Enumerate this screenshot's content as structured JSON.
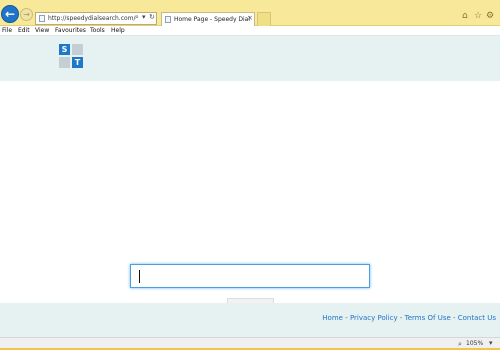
{
  "browser": {
    "address_url": "http://speedydialsearch.com/",
    "tab_title": "Home Page - Speedy Dial",
    "zoom": "105%",
    "menu": [
      "File",
      "Edit",
      "View",
      "Favourites",
      "Tools",
      "Help"
    ]
  },
  "page": {
    "logo": {
      "left": "S",
      "right": "T"
    },
    "footer": {
      "links": [
        "Home",
        "Privacy Policy",
        "Terms Of Use",
        "Contact Us"
      ],
      "separator": " - "
    }
  },
  "colors": {
    "chrome_bg": "#f8e89a",
    "header_footer_bg": "#e6f1f1",
    "accent_blue": "#1d78c8",
    "link_blue": "#1f74c7",
    "gold_bar": "#f3c34a"
  }
}
